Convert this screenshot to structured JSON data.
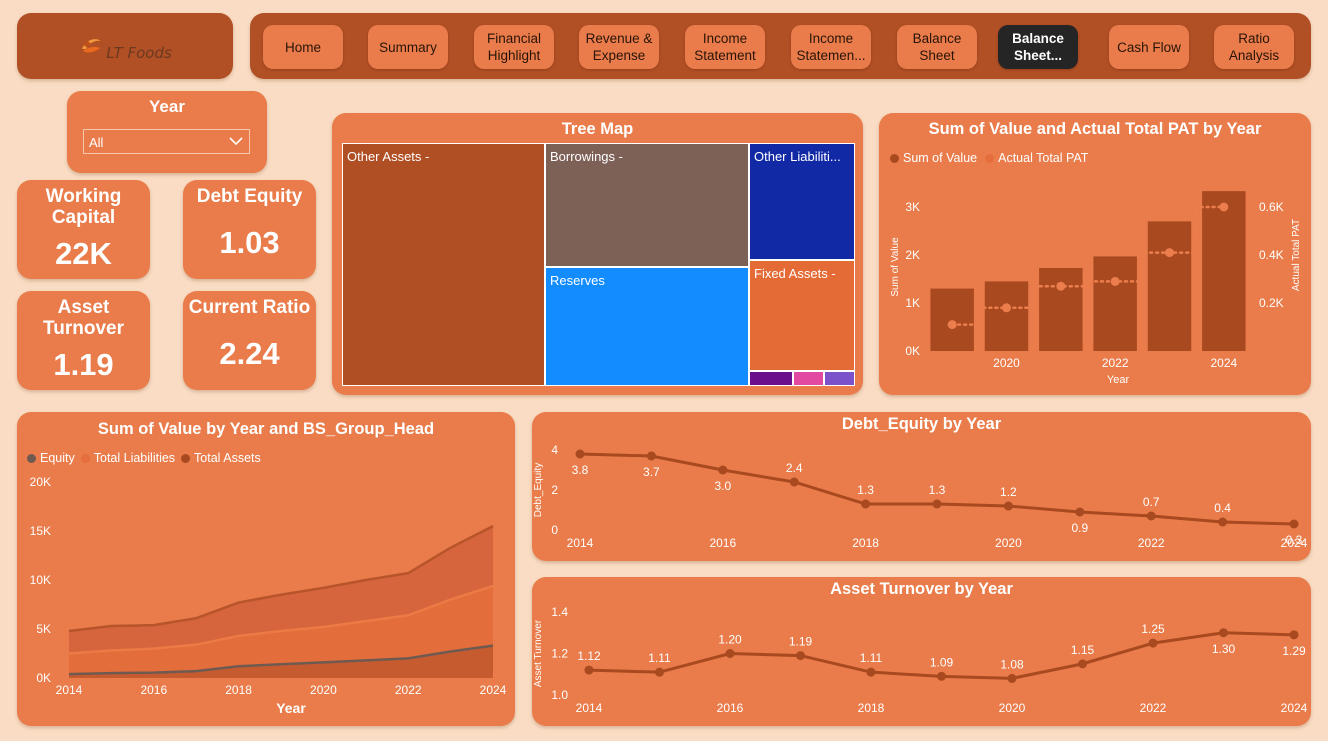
{
  "brand": {
    "name": "LT Foods"
  },
  "nav": {
    "items": [
      {
        "label": "Home"
      },
      {
        "label": "Summary"
      },
      {
        "label": "Financial\nHighlight"
      },
      {
        "label": "Revenue &\nExpense"
      },
      {
        "label": "Income\nStatement"
      },
      {
        "label": "Income\nStatemen..."
      },
      {
        "label": "Balance\nSheet"
      },
      {
        "label": "Balance\nSheet...",
        "active": true
      },
      {
        "label": "Cash Flow"
      },
      {
        "label": "Ratio\nAnalysis"
      }
    ]
  },
  "filter": {
    "title": "Year",
    "value": "All",
    "icon": "chevron-down-icon"
  },
  "kpis": {
    "working_capital": {
      "title": "Working Capital",
      "value": "22K"
    },
    "debt_equity": {
      "title": "Debt Equity",
      "value": "1.03"
    },
    "asset_turnover": {
      "title": "Asset Turnover",
      "value": "1.19"
    },
    "current_ratio": {
      "title": "Current Ratio",
      "value": "2.24"
    }
  },
  "treemap": {
    "title": "Tree Map",
    "tiles": [
      {
        "label": "Other Assets -",
        "color": "#b04f24"
      },
      {
        "label": "Borrowings -",
        "color": "#7d6056"
      },
      {
        "label": "Reserves",
        "color": "#128cff"
      },
      {
        "label": "Other Liabiliti...",
        "color": "#1229a5"
      },
      {
        "label": "Fixed Assets -",
        "color": "#e46a36"
      },
      {
        "label": "",
        "color": "#6b0f8c"
      },
      {
        "label": "",
        "color": "#e14aa0"
      },
      {
        "label": "",
        "color": "#7b52c9"
      }
    ]
  },
  "colors": {
    "dark": "#a8491f",
    "mid": "#d2603b",
    "light": "#e66e3c",
    "grey": "#6f5a51",
    "accent": "#e97c4a"
  },
  "chart_data": [
    {
      "type": "bar",
      "title": "Sum of Value and Actual Total PAT by Year",
      "xlabel": "Year",
      "ylabel": "Sum of Value",
      "y2label": "Actual Total PAT",
      "legend": [
        "Sum of Value",
        "Actual Total PAT"
      ],
      "x": [
        2019,
        2020,
        2021,
        2022,
        2023,
        2024
      ],
      "x_ticks": [
        "2020",
        "2022",
        "2024"
      ],
      "y_ticks": [
        "0K",
        "1K",
        "2K",
        "3K"
      ],
      "y2_ticks": [
        "0.2K",
        "0.4K",
        "0.6K"
      ],
      "ylim": [
        0,
        3500
      ],
      "y2lim": [
        0,
        0.7
      ],
      "series": [
        {
          "name": "Sum of Value",
          "type": "bar",
          "values": [
            1300,
            1450,
            1730,
            1970,
            2700,
            3330
          ]
        },
        {
          "name": "Actual Total PAT",
          "type": "line",
          "axis": "secondary",
          "values": [
            0.11,
            0.18,
            0.27,
            0.29,
            0.41,
            0.6
          ]
        }
      ]
    },
    {
      "type": "area",
      "title": "Sum of Value by Year and BS_Group_Head",
      "xlabel": "Year",
      "legend": [
        "Equity",
        "Total Liabilities",
        "Total Assets"
      ],
      "x": [
        2014,
        2015,
        2016,
        2017,
        2018,
        2019,
        2020,
        2021,
        2022,
        2023,
        2024
      ],
      "x_ticks": [
        "2014",
        "2016",
        "2018",
        "2020",
        "2022",
        "2024"
      ],
      "y_ticks": [
        "0K",
        "5K",
        "10K",
        "15K",
        "20K"
      ],
      "ylim": [
        0,
        20000
      ],
      "series": [
        {
          "name": "Total Assets",
          "values": [
            4800,
            5300,
            5400,
            6100,
            7700,
            8500,
            9200,
            10000,
            10700,
            13300,
            15500
          ]
        },
        {
          "name": "Total Liabilities",
          "values": [
            2500,
            2800,
            3000,
            3400,
            4300,
            4800,
            5200,
            5800,
            6400,
            8000,
            9400
          ]
        },
        {
          "name": "Equity",
          "values": [
            400,
            500,
            550,
            700,
            1200,
            1400,
            1600,
            1800,
            2000,
            2700,
            3300
          ]
        }
      ]
    },
    {
      "type": "line",
      "title": "Debt_Equity by Year",
      "ylabel": "Debt_Equity",
      "x": [
        2014,
        2015,
        2016,
        2017,
        2018,
        2019,
        2020,
        2021,
        2022,
        2023,
        2024
      ],
      "x_ticks": [
        "2014",
        "2016",
        "2018",
        "2020",
        "2022",
        "2024"
      ],
      "y_ticks": [
        "0",
        "2",
        "4"
      ],
      "ylim": [
        0,
        4
      ],
      "values": [
        3.8,
        3.7,
        3.0,
        2.4,
        1.3,
        1.3,
        1.2,
        0.9,
        0.7,
        0.4,
        0.3
      ],
      "data_labels": [
        "3.8",
        "3.7",
        "3.0",
        "2.4",
        "1.3",
        "1.3",
        "1.2",
        "0.9",
        "0.7",
        "0.4",
        "0.3"
      ]
    },
    {
      "type": "line",
      "title": "Asset Turnover by Year",
      "ylabel": "Asset Turnover",
      "x": [
        2014,
        2015,
        2016,
        2017,
        2018,
        2019,
        2020,
        2021,
        2022,
        2023,
        2024
      ],
      "x_ticks": [
        "2014",
        "2016",
        "2018",
        "2020",
        "2022",
        "2024"
      ],
      "y_ticks": [
        "1.0",
        "1.2",
        "1.4"
      ],
      "ylim": [
        1.0,
        1.4
      ],
      "values": [
        1.12,
        1.11,
        1.2,
        1.19,
        1.11,
        1.09,
        1.08,
        1.15,
        1.25,
        1.3,
        1.29
      ],
      "data_labels": [
        "1.12",
        "1.11",
        "1.20",
        "1.19",
        "1.11",
        "1.09",
        "1.08",
        "1.15",
        "1.25",
        "1.30",
        "1.29"
      ]
    }
  ]
}
